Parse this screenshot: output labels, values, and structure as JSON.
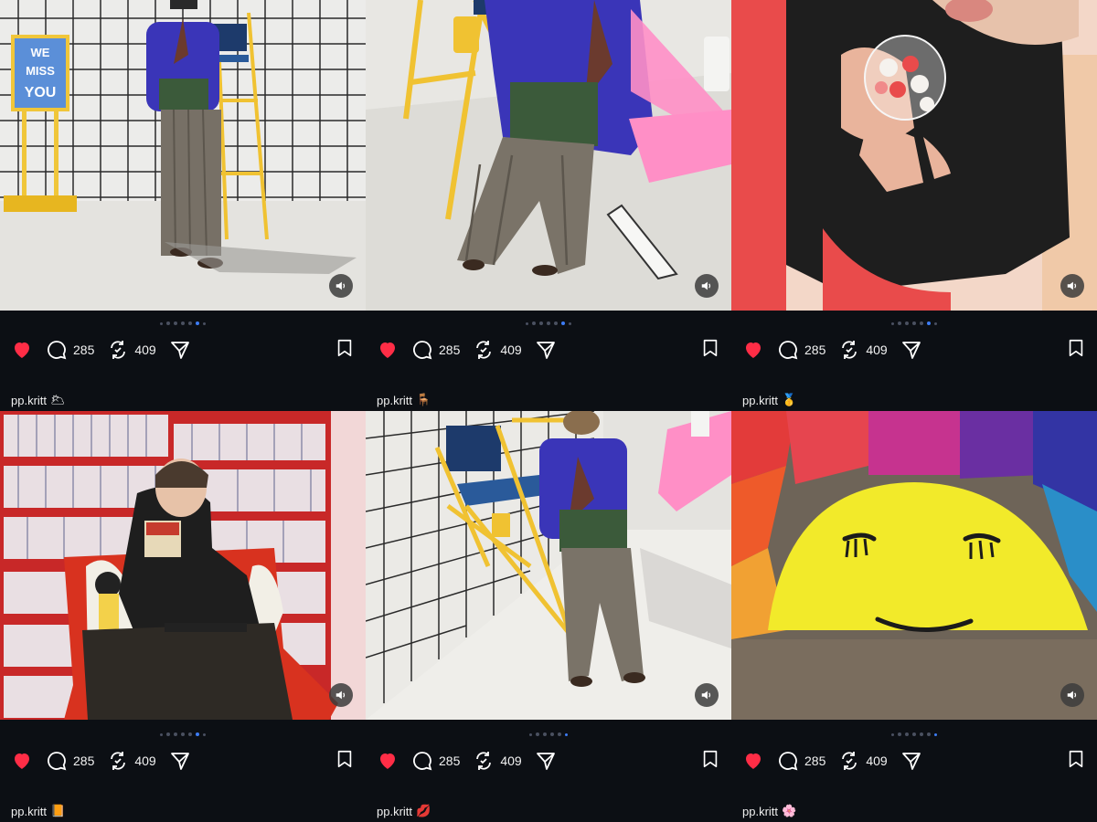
{
  "posts": [
    {
      "username": "pp.kritt",
      "emoji": "🌥",
      "comments": "285",
      "reposts": "409",
      "dots": 7,
      "active_dot": 5,
      "sign_text": "WE MISS YOU"
    },
    {
      "username": "pp.kritt",
      "emoji": "🪑",
      "comments": "285",
      "reposts": "409",
      "dots": 7,
      "active_dot": 5
    },
    {
      "username": "pp.kritt",
      "emoji": "🥇",
      "comments": "285",
      "reposts": "409",
      "dots": 7,
      "active_dot": 5
    },
    {
      "username": "pp.kritt",
      "emoji": "📙",
      "comments": "285",
      "reposts": "409",
      "dots": 7,
      "active_dot": 5
    },
    {
      "username": "pp.kritt",
      "emoji": "💋",
      "comments": "285",
      "reposts": "409",
      "dots": 6,
      "active_dot": 5
    },
    {
      "username": "pp.kritt",
      "emoji": "🌸",
      "comments": "285",
      "reposts": "409",
      "dots": 7,
      "active_dot": 6
    }
  ],
  "icons": {
    "like": "heart-icon",
    "comment": "comment-icon",
    "repost": "repost-icon",
    "share": "send-icon",
    "save": "bookmark-icon",
    "sound": "speaker-icon"
  },
  "colors": {
    "background": "#0c0f14",
    "like": "#ff2d46",
    "active_dot": "#3d7cf5"
  }
}
